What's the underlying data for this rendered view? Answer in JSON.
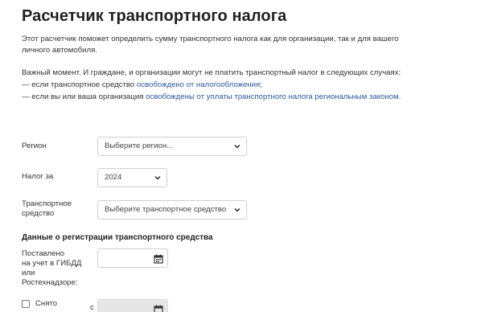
{
  "page": {
    "title": "Расчетчик транспортного налога",
    "intro_line1": "Этот расчетчик поможет определить сумму транспортного налога как для организации, так и для вашего",
    "intro_line2": "личного автомобиля.",
    "important": "Важный момент. И граждане, и организации могут не платить транспортный налог в следующих случаях:",
    "item1_prefix": "— если транспортное средство ",
    "item1_link": "освобождено от налогообложения",
    "item1_suffix": ";",
    "item2_prefix": "— если вы или ваша организация ",
    "item2_link": "освобождены от уплаты транспортного налога региональным законом",
    "item2_suffix": "."
  },
  "form": {
    "region_label": "Регион",
    "region_placeholder": "Выберите регион...",
    "tax_for_label": "Налог за",
    "tax_year": "2024",
    "vehicle_label_line1": "Транспортное",
    "vehicle_label_line2": "средство",
    "vehicle_placeholder": "Выберите транспортное средство",
    "section_title": "Данные о регистрации транспортного средства",
    "registered_line1": "Поставлено",
    "registered_line2": "на учет в ГИБДД",
    "registered_line3": "или",
    "registered_line4": "Ростехнадзоре:",
    "removed_label": "Снято",
    "from_label": "с"
  },
  "colors": {
    "link": "#2a5a9e",
    "border": "#cfcfcf",
    "disabled_bg": "#e6e6e6"
  },
  "icons": {
    "dropdown": "chevron-down-icon",
    "calendar": "calendar-icon"
  }
}
